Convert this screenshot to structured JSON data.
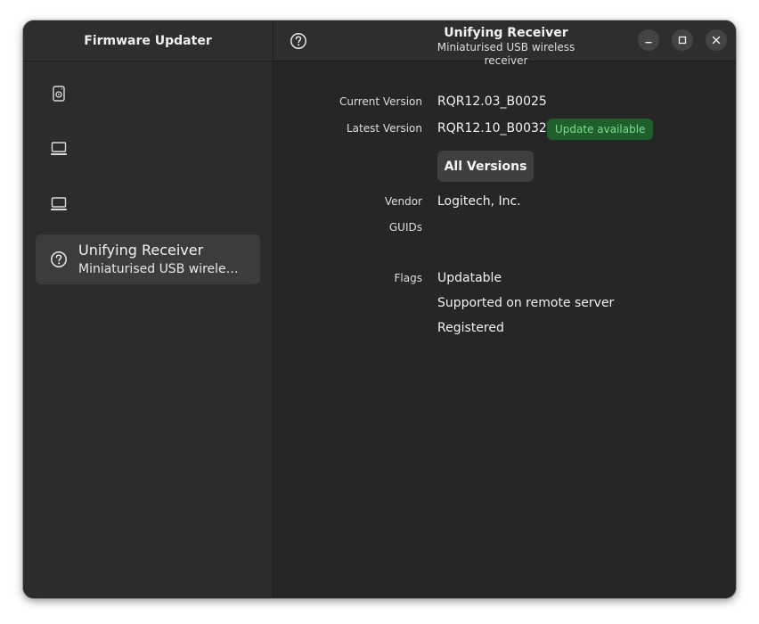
{
  "sidebar": {
    "title": "Firmware Updater",
    "devices": [
      {
        "icon": "drive-icon",
        "name": "",
        "subtitle": ""
      },
      {
        "icon": "computer-icon",
        "name": "",
        "subtitle": ""
      },
      {
        "icon": "computer-icon",
        "name": "",
        "subtitle": ""
      },
      {
        "icon": "help-circle-icon",
        "name": "Unifying Receiver",
        "subtitle": "Miniaturised USB wireles…"
      }
    ]
  },
  "header": {
    "title": "Unifying Receiver",
    "subtitle": "Miniaturised USB wireless receiver"
  },
  "details": {
    "current_version_label": "Current Version",
    "current_version": "RQR12.03_B0025",
    "latest_version_label": "Latest Version",
    "latest_version": "RQR12.10_B0032",
    "update_badge": "Update available",
    "all_versions_button": "All Versions",
    "vendor_label": "Vendor",
    "vendor": "Logitech, Inc.",
    "guids_label": "GUIDs",
    "flags_label": "Flags",
    "flags": [
      "Updatable",
      "Supported on remote server",
      "Registered"
    ]
  },
  "colors": {
    "window_bg": "#2a2a2a",
    "badge_bg": "#1f5f2b",
    "badge_text": "#7fdc8d",
    "selected_row": "#3c3c3c"
  }
}
